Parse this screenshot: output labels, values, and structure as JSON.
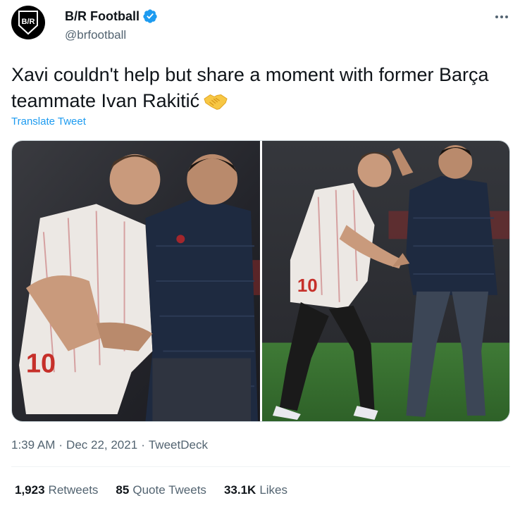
{
  "author": {
    "display_name": "B/R Football",
    "handle": "@brfootball",
    "avatar_logo_text": "B/R",
    "verified": true
  },
  "tweet": {
    "text": "Xavi couldn't help but share a moment with former Barça teammate Ivan Rakitić",
    "emoji": "handshake",
    "translate_label": "Translate Tweet"
  },
  "media": {
    "count": 2,
    "left_photo_desc": "two players embracing",
    "right_photo_desc": "handshake on pitch"
  },
  "meta": {
    "time": "1:39 AM",
    "separator1": "·",
    "date": "Dec 22, 2021",
    "separator2": "·",
    "source": "TweetDeck"
  },
  "stats": {
    "retweets_num": "1,923",
    "retweets_label": "Retweets",
    "quotes_num": "85",
    "quotes_label": "Quote Tweets",
    "likes_num": "33.1K",
    "likes_label": "Likes"
  },
  "colors": {
    "accent": "#1d9bf0",
    "text": "#0f1419",
    "secondary": "#536471"
  }
}
